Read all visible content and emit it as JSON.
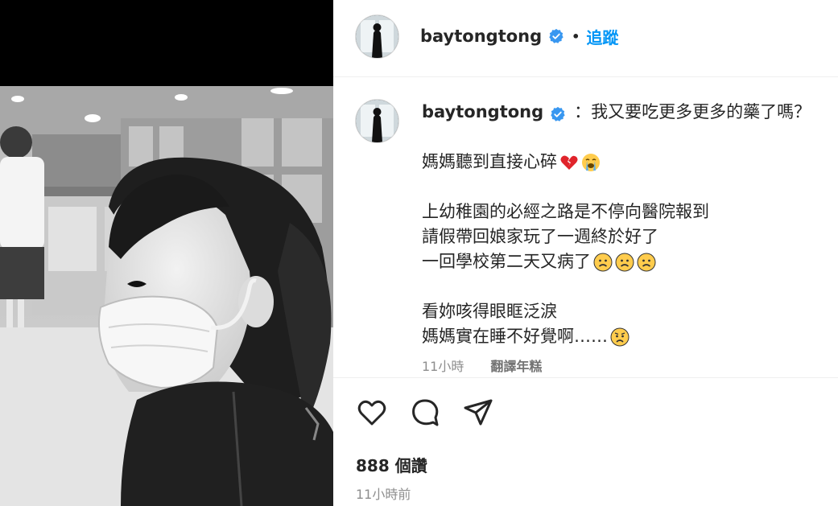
{
  "post": {
    "username": "baytongtong",
    "verified": true,
    "follow_label": "追蹤",
    "header_separator": "•"
  },
  "caption": {
    "username": "baytongtong",
    "line1": "：我又要吃更多更多的藥了嗎？",
    "line2": "媽媽聽到直接心碎",
    "line3": "上幼稚園的必經之路是不停向醫院報到",
    "line4": "請假帶回娘家玩了一週終於好了",
    "line5": "一回學校第二天又病了",
    "line6": "看妳咳得眼眶泛淚",
    "line7": "媽媽實在睡不好覺啊……",
    "line2_emojis": [
      "broken-heart-emoji",
      "loudly-crying-face-emoji"
    ],
    "line5_emojis": [
      "slightly-frowning-face-emoji",
      "slightly-frowning-face-emoji",
      "slightly-frowning-face-emoji"
    ],
    "line7_emojis": [
      "worried-face-emoji"
    ]
  },
  "caption_meta": {
    "age": "11小時",
    "translate_label": "翻譯年糕"
  },
  "actions": {
    "icons": [
      "heart-icon",
      "comment-icon",
      "share-icon"
    ]
  },
  "likes_label": "888 個讚",
  "timestamp": "11小時前",
  "colors": {
    "link_blue": "#0095f6",
    "verified_blue": "#3897f0",
    "text": "#262626",
    "secondary": "#8e8e8e"
  }
}
